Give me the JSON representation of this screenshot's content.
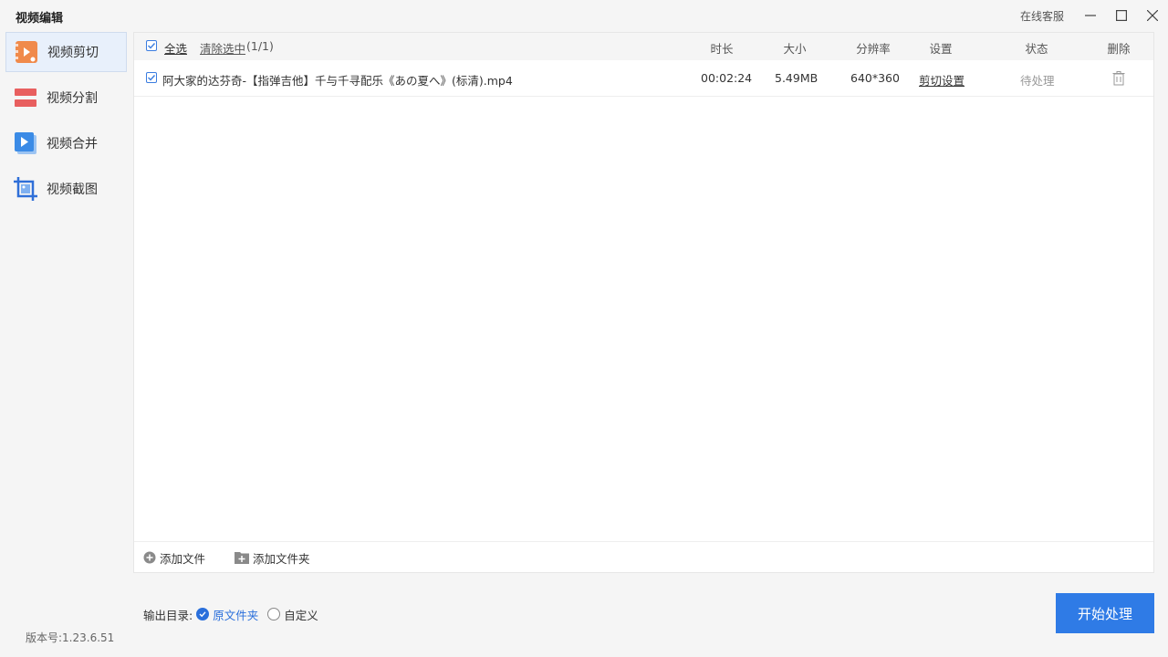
{
  "app": {
    "title": "视频编辑",
    "support_label": "在线客服",
    "version": "版本号:1.23.6.51"
  },
  "colors": {
    "accent": "#2f7be6",
    "sidebar_active_bg": "#e8f0fb",
    "cut_icon": "#f08a4b",
    "split_icon": "#e85f5f",
    "merge_icon": "#3b8be6",
    "screenshot_icon": "#2f6fd8"
  },
  "sidebar": {
    "items": [
      {
        "label": "视频剪切",
        "icon": "video-cut-icon",
        "active": true
      },
      {
        "label": "视频分割",
        "icon": "video-split-icon",
        "active": false
      },
      {
        "label": "视频合并",
        "icon": "video-merge-icon",
        "active": false
      },
      {
        "label": "视频截图",
        "icon": "video-screenshot-icon",
        "active": false
      }
    ]
  },
  "table": {
    "select_all": "全选",
    "clear_selection": "清除选中",
    "selection_count": "(1/1)",
    "headers": {
      "duration": "时长",
      "size": "大小",
      "resolution": "分辨率",
      "settings": "设置",
      "status": "状态",
      "delete": "删除"
    },
    "rows": [
      {
        "checked": true,
        "filename": "阿大家的达芬奇-【指弹吉他】千与千寻配乐《あの夏へ》(标清).mp4",
        "duration": "00:02:24",
        "size": "5.49MB",
        "resolution": "640*360",
        "settings_link": "剪切设置",
        "status": "待处理"
      }
    ]
  },
  "footer": {
    "add_file": "添加文件",
    "add_folder": "添加文件夹"
  },
  "output": {
    "label": "输出目录:",
    "options": [
      {
        "label": "原文件夹",
        "selected": true
      },
      {
        "label": "自定义",
        "selected": false
      }
    ]
  },
  "start_button": "开始处理"
}
